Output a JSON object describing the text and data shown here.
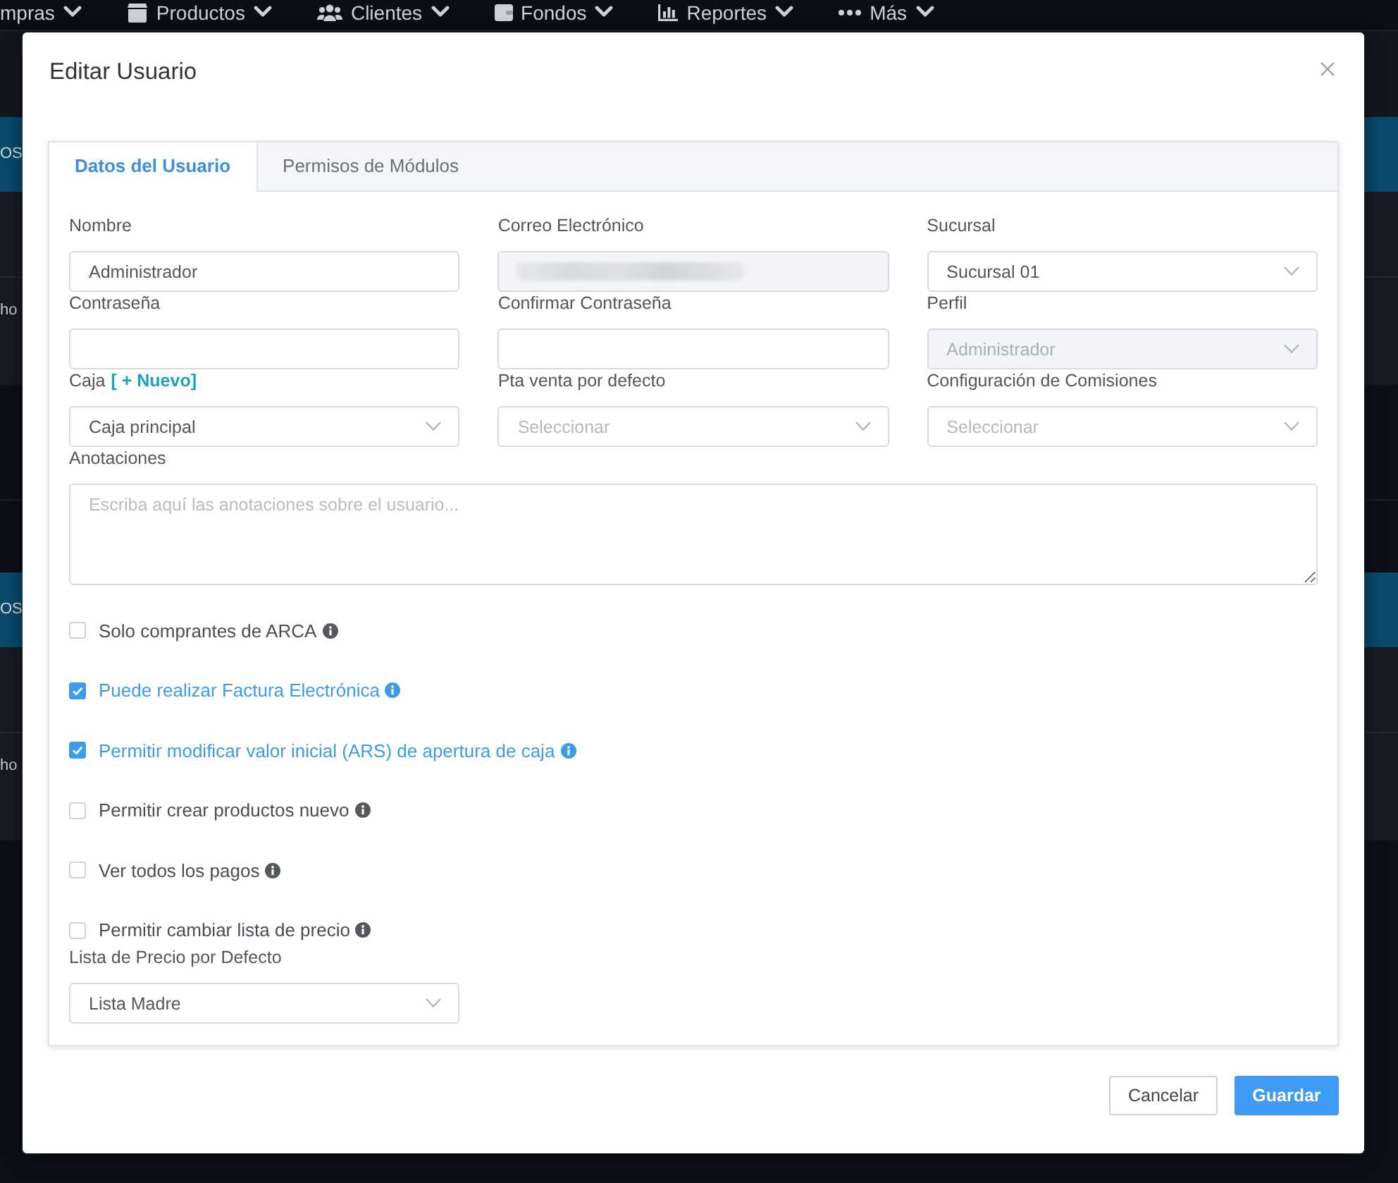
{
  "nav": {
    "items": [
      {
        "label": "mpras"
      },
      {
        "label": "Productos"
      },
      {
        "label": "Clientes"
      },
      {
        "label": "Fondos"
      },
      {
        "label": "Reportes"
      },
      {
        "label": "Más"
      }
    ]
  },
  "background": {
    "tables": [
      {
        "header": "OS",
        "cell": "ho"
      },
      {
        "header": "OS",
        "cell": "ho"
      }
    ]
  },
  "modal": {
    "title": "Editar Usuario",
    "tabs": [
      {
        "label": "Datos del Usuario",
        "selected": true
      },
      {
        "label": "Permisos de Módulos",
        "selected": false
      }
    ],
    "fields": [
      {
        "label": "Nombre",
        "kind": "text",
        "value": "Administrador",
        "disabled": false,
        "blurred": false
      },
      {
        "label": "Correo Electrónico",
        "kind": "text",
        "disabled": true,
        "blurred": true
      },
      {
        "label": "Sucursal",
        "kind": "select",
        "value": "Sucursal 01",
        "disabled": false,
        "blurred": false
      },
      {
        "label": "Contraseña",
        "kind": "text",
        "disabled": false,
        "blurred": false
      },
      {
        "label": "Confirmar Contraseña",
        "kind": "text",
        "disabled": false,
        "blurred": false
      },
      {
        "label": "Perfil",
        "kind": "select",
        "value": "Administrador",
        "disabled": true,
        "blurred": false
      },
      {
        "label": "Caja",
        "link": "[ + Nuevo]",
        "kind": "select",
        "value": "Caja principal",
        "disabled": false,
        "blurred": false
      },
      {
        "label": "Pta venta por defecto",
        "kind": "select",
        "placeholder": "Seleccionar",
        "disabled": false,
        "blurred": false
      },
      {
        "label": "Configuración de Comisiones",
        "kind": "select",
        "placeholder": "Seleccionar",
        "disabled": false,
        "blurred": false
      }
    ],
    "notes": {
      "label": "Anotaciones",
      "placeholder": "Escriba aquí las anotaciones sobre el usuario..."
    },
    "options": [
      {
        "label": "Solo comprantes de ARCA",
        "checked": false
      },
      {
        "label": "Puede realizar Factura Electrónica",
        "checked": true
      },
      {
        "label": "Permitir modificar valor inicial (ARS) de apertura de caja",
        "checked": true
      },
      {
        "label": "Permitir crear productos nuevo",
        "checked": false
      },
      {
        "label": "Ver todos los pagos",
        "checked": false
      },
      {
        "label": "Permitir cambiar lista de precio",
        "checked": false
      }
    ],
    "price_list": {
      "label": "Lista de Precio por Defecto",
      "value": "Lista Madre"
    },
    "buttons": [
      {
        "label": "Cancelar",
        "kind": "secondary"
      },
      {
        "label": "Guardar",
        "kind": "primary"
      }
    ]
  }
}
